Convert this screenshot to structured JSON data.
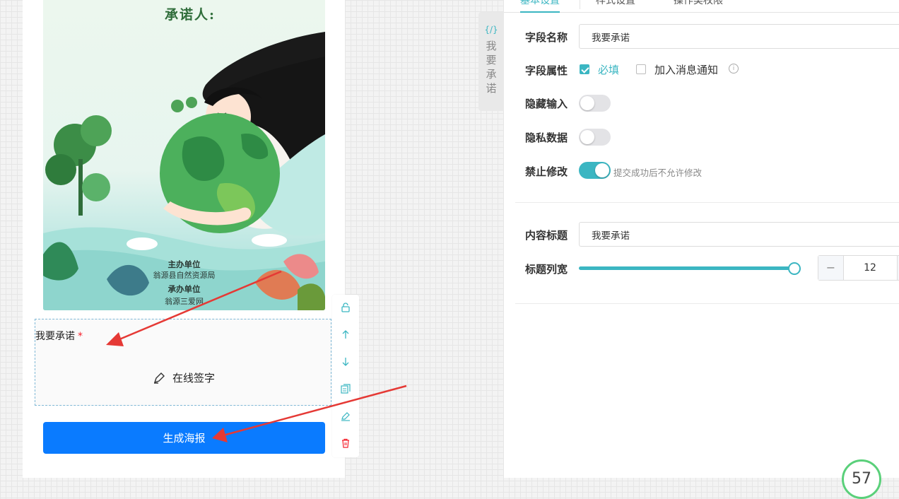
{
  "preview": {
    "poster_title": "承诺人:",
    "organizer_label": "主办单位",
    "organizer_name": "翁源县自然资源局",
    "coorganizer_label": "承办单位",
    "coorganizer_name": "翁源三爱网"
  },
  "field": {
    "label": "我要承诺",
    "required_mark": "*",
    "sign_button": "在线签字"
  },
  "generate_button": "生成海报",
  "tool_icons": [
    "unlock-icon",
    "arrow-up-icon",
    "arrow-down-icon",
    "copy-icon",
    "edit-icon",
    "delete-icon"
  ],
  "side_tab": {
    "code": "{/}",
    "label": "我要承诺"
  },
  "settings": {
    "tabs": [
      "基本设置",
      "样式设置",
      "操作类权限"
    ],
    "field_name_label": "字段名称",
    "field_name_value": "我要承诺",
    "field_attr_label": "字段属性",
    "required_label": "必填",
    "required_checked": true,
    "notify_label": "加入消息通知",
    "notify_checked": false,
    "hide_input_label": "隐藏输入",
    "hide_input_on": false,
    "private_label": "隐私数据",
    "private_on": false,
    "lock_edit_label": "禁止修改",
    "lock_edit_on": true,
    "lock_edit_hint": "提交成功后不允许修改",
    "content_title_label": "内容标题",
    "content_title_value": "我要承诺",
    "title_width_label": "标题列宽",
    "title_width_value": "12",
    "title_width_fraction": 1.0
  },
  "score": "57",
  "colors": {
    "accent": "#3bb6c2",
    "primary_button": "#0a7bff",
    "required": "#f5222d",
    "annotation_arrow": "#e53935"
  }
}
